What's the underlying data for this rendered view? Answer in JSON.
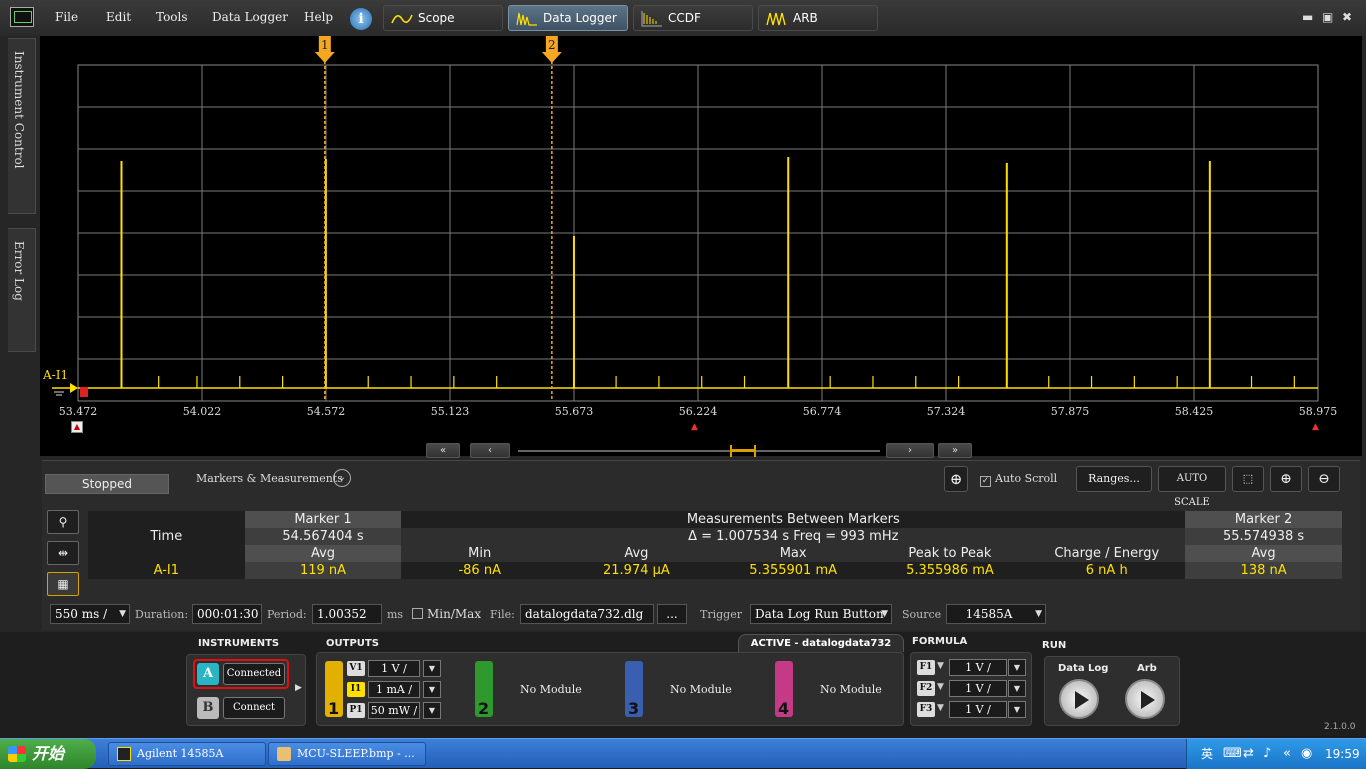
{
  "menu": {
    "file": "File",
    "edit": "Edit",
    "tools": "Tools",
    "data_logger": "Data Logger",
    "help": "Help"
  },
  "tabs": [
    {
      "label": "Scope"
    },
    {
      "label": "Data Logger"
    },
    {
      "label": "CCDF"
    },
    {
      "label": "ARB"
    }
  ],
  "side_tabs": {
    "instrument_control": "Instrument Control",
    "error_log": "Error Log"
  },
  "plot": {
    "trace_label": "A-I1",
    "marker1_label": "1",
    "marker2_label": "2",
    "x_ticks": [
      "53.472",
      "54.022",
      "54.572",
      "55.123",
      "55.673",
      "56.224",
      "56.774",
      "57.324",
      "57.875",
      "58.425",
      "58.975"
    ],
    "x_range": [
      53.472,
      58.975
    ],
    "marker1_x": 54.567404,
    "marker2_x": 55.574938,
    "trace_color": "#ffe000",
    "marker_color": "#f5a623"
  },
  "panel": {
    "status": "Stopped",
    "markers_title": "Markers & Measurements",
    "auto_scroll": "Auto Scroll",
    "ranges": "Ranges...",
    "auto_scale": "AUTO SCALE"
  },
  "table": {
    "marker1": "Marker 1",
    "between": "Measurements Between Markers",
    "marker2": "Marker 2",
    "time_label": "Time",
    "marker1_time": "54.567404 s",
    "delta": "Δ = 1.007534 s   Freq = 993 mHz",
    "marker2_time": "55.574938 s",
    "avg": "Avg",
    "min": "Min",
    "avg2": "Avg",
    "max": "Max",
    "p2p": "Peak to Peak",
    "charge": "Charge / Energy",
    "avg3": "Avg",
    "row_label": "A-I1",
    "m1_avg": "119 nA",
    "min_val": "-86 nA",
    "avg_val": "21.974 µA",
    "max_val": "5.355901 mA",
    "p2p_val": "5.355986 mA",
    "charge_val": "6 nA h",
    "m2_avg": "138 nA"
  },
  "bottom": {
    "timescale": "550 ms /",
    "duration_label": "Duration:",
    "duration": "000:01:30",
    "period_label": "Period:",
    "period": "1.00352",
    "period_unit": "ms",
    "minmax": "Min/Max",
    "file_label": "File:",
    "file": "datalogdata732.dlg",
    "file_btn": "...",
    "trigger_label": "Trigger",
    "trigger": "Data Log Run Button",
    "source_label": "Source",
    "source": "14585A"
  },
  "instruments": {
    "title": "INSTRUMENTS",
    "a": "A",
    "a_status": "Connected",
    "b": "B",
    "b_status": "Connect",
    "outputs_title": "OUTPUTS",
    "active_title": "ACTIVE - datalogdata732",
    "ch1": {
      "num": "1",
      "v_lbl": "V1",
      "v": "1 V /",
      "i_lbl": "I1",
      "i": "1 mA /",
      "p_lbl": "P1",
      "p": "50 mW /"
    },
    "ch2": {
      "num": "2",
      "text": "No Module"
    },
    "ch3": {
      "num": "3",
      "text": "No Module"
    },
    "ch4": {
      "num": "4",
      "text": "No Module"
    },
    "formula_title": "FORMULA",
    "f1_lbl": "F1",
    "f1": "1 V /",
    "f2_lbl": "F2",
    "f2": "1 V /",
    "f3_lbl": "F3",
    "f3": "1 V /",
    "run_title": "RUN",
    "data_log": "Data Log",
    "arb": "Arb",
    "version": "2.1.0.0"
  },
  "taskbar": {
    "start": "开始",
    "task1": "Agilent 14585A",
    "task2": "MCU-SLEEP.bmp - ...",
    "ime": "英",
    "clock": "19:59"
  }
}
